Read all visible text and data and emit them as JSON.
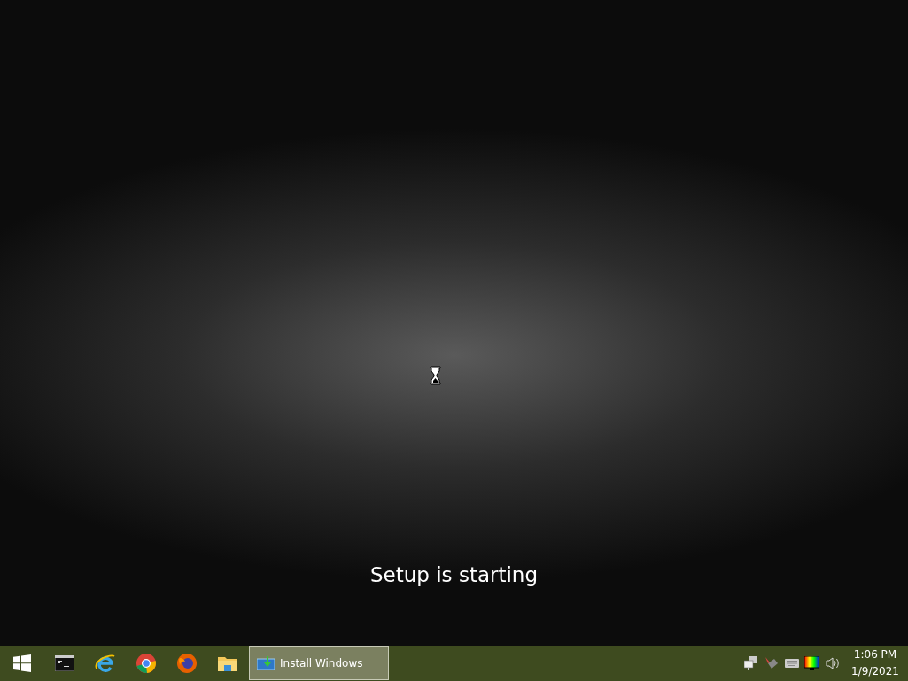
{
  "desktop": {
    "message": "Setup is starting"
  },
  "taskbar": {
    "apps": [
      {
        "kind": "terminal"
      },
      {
        "kind": "ie"
      },
      {
        "kind": "chrome"
      },
      {
        "kind": "firefox"
      },
      {
        "kind": "folder"
      }
    ],
    "tasks": [
      {
        "label": "Install Windows",
        "selected": true
      }
    ],
    "tray": [
      {
        "kind": "network"
      },
      {
        "kind": "pen"
      },
      {
        "kind": "keyboard"
      },
      {
        "kind": "display"
      },
      {
        "kind": "volume"
      }
    ],
    "clock": {
      "time": "1:06 PM",
      "date": "1/9/2021"
    }
  }
}
